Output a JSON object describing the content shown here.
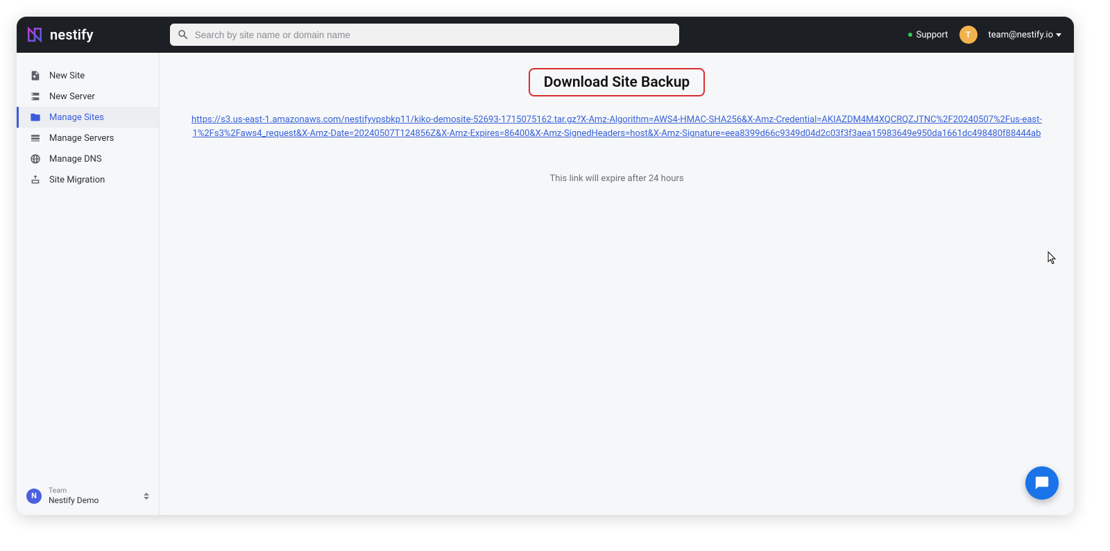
{
  "header": {
    "brand": "nestify",
    "search_placeholder": "Search by site name or domain name",
    "support_label": "Support",
    "avatar_letter": "T",
    "user_email": "team@nestify.io"
  },
  "sidebar": {
    "items": [
      {
        "label": "New Site"
      },
      {
        "label": "New Server"
      },
      {
        "label": "Manage Sites"
      },
      {
        "label": "Manage Servers"
      },
      {
        "label": "Manage DNS"
      },
      {
        "label": "Site Migration"
      }
    ],
    "team_label": "Team",
    "team_name": "Nestify Demo",
    "team_avatar_letter": "N"
  },
  "main": {
    "title": "Download Site Backup",
    "backup_url": "https://s3.us-east-1.amazonaws.com/nestifyvpsbkp11/kiko-demosite-52693-1715075162.tar.gz?X-Amz-Algorithm=AWS4-HMAC-SHA256&X-Amz-Credential=AKIAZDM4M4XQCRQZJTNC%2F20240507%2Fus-east-1%2Fs3%2Faws4_request&X-Amz-Date=20240507T124856Z&X-Amz-Expires=86400&X-Amz-SignedHeaders=host&X-Amz-Signature=eea8399d66c9349d04d2c03f3f3aea15983649e950da1661dc498480f88444ab",
    "expiry_note": "This link will expire after 24 hours"
  }
}
